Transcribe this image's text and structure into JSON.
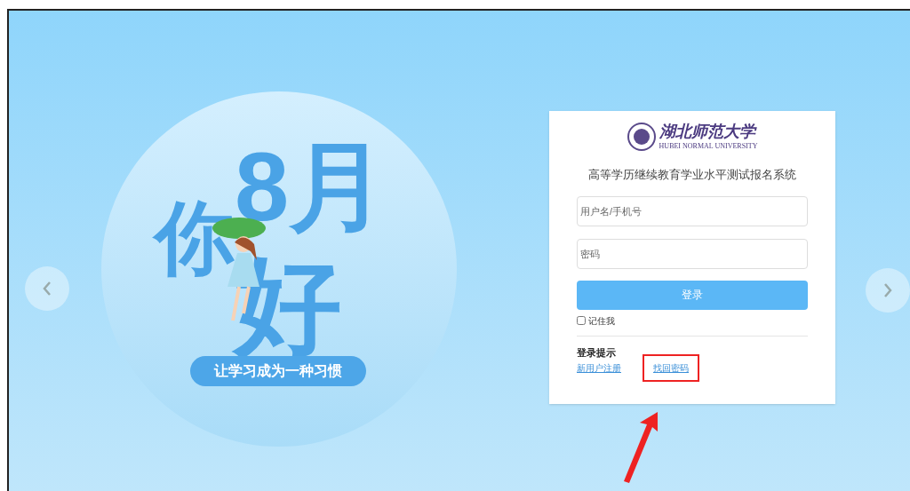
{
  "banner": {
    "month": "8月",
    "char_left": "你",
    "char_bottom": "好",
    "slogan": "让学习成为一种习惯"
  },
  "carousel": {
    "has_prev": true,
    "has_next": true
  },
  "login": {
    "logo_name": "湖北师范大学",
    "logo_subtitle": "HUBEI NORMAL UNIVERSITY",
    "system_title": "高等学历继续教育学业水平测试报名系统",
    "username": {
      "placeholder": "用户名/手机号"
    },
    "password": {
      "placeholder": "密码"
    },
    "submit": "登录",
    "remember": {
      "label": "记住我",
      "checked": false
    },
    "tips_heading": "登录提示",
    "links": [
      {
        "label": "新用户注册",
        "highlighted": false
      },
      {
        "label": "找回密码",
        "highlighted": true
      }
    ]
  }
}
